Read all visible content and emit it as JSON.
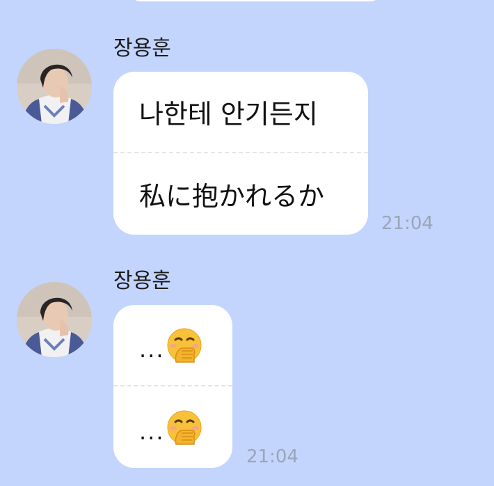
{
  "messages": [
    {
      "sender": "장용훈",
      "avatar_icon": "profile-photo-avatar",
      "lines": [
        "나한테 안기든지",
        "私に抱かれるか"
      ],
      "time": "21:04"
    },
    {
      "sender": "장용훈",
      "avatar_icon": "profile-photo-avatar",
      "lines": [
        "...",
        "..."
      ],
      "line_emoji": "face-with-hand-over-mouth-emoji",
      "time": "21:04"
    }
  ]
}
